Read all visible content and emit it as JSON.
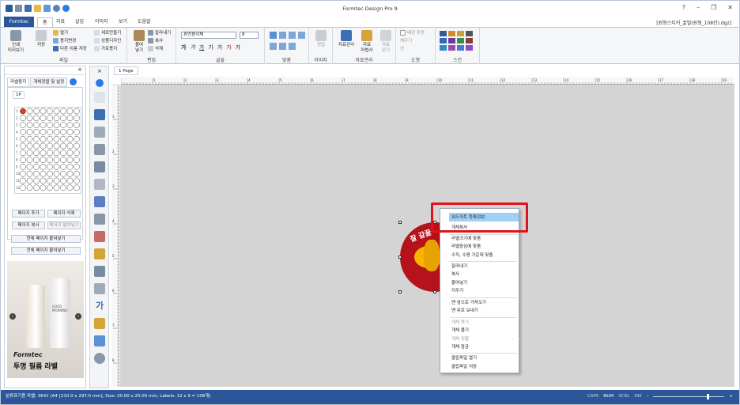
{
  "app": {
    "title": "Formtec Design Pro 9",
    "filename": "[원형스티커_꿀벌(원형_108칸).dgz]",
    "window_controls": [
      "?",
      "–",
      "❐",
      "✕"
    ]
  },
  "tabs": [
    "Formtec",
    "홈",
    "자료",
    "삽입",
    "이미지",
    "보기",
    "도움말"
  ],
  "ribbon": {
    "file": {
      "label": "파일",
      "print_preview": "인쇄\n미리보기",
      "save": "저장",
      "open": "열기",
      "paper_change": "용지변경",
      "save_as": "다른 이름 저장",
      "new_page": "새로만들기",
      "product_design": "상품디자인",
      "horizontal_paper": "가로용지"
    },
    "edit": {
      "label": "편집",
      "paste": "붙여\n넣기",
      "cut": "잘라내기",
      "copy": "복사",
      "delete": "삭제"
    },
    "font": {
      "label": "글꼴",
      "font_name": "휴먼편지체",
      "font_size": "8",
      "styles": [
        "가",
        "가",
        "가",
        "가",
        "가",
        "·",
        "가",
        "·",
        "가",
        "가"
      ]
    },
    "align": {
      "label": "맞춤"
    },
    "image": {
      "label": "이미지",
      "edit": "편집"
    },
    "data": {
      "label": "자료관리",
      "data_mgmt": "자료관리",
      "data_wizard": "자료\n마법사",
      "data_close": "자료\n닫기"
    },
    "shape": {
      "label": "도형",
      "fill": "배경 투명",
      "line_color": "채우기",
      "line": "선"
    },
    "skin": {
      "label": "스킨"
    }
  },
  "left_panel": {
    "tabs": [
      "라벨용지",
      "개체정렬 및 설정"
    ],
    "page_tab": "1P",
    "row_numbers": [
      "1",
      "2",
      "3",
      "4",
      "5",
      "6",
      "7",
      "8",
      "9",
      "10",
      "11",
      "12"
    ],
    "buttons": {
      "add_page": "페이지 추가",
      "delete_page": "페이지 삭제",
      "copy_page": "페이지 복사",
      "paste_page": "페이지 붙여넣기",
      "paste_current": "현재 페이지 붙여넣기",
      "paste_all": "전체 페이지 붙여넣기"
    },
    "ad": {
      "brand": "Formtec",
      "caption": "투명 필름 라벨",
      "bottle_text": "GOOD MORNING"
    }
  },
  "document": {
    "tab": "1 Page",
    "ruler_ticks_h": [
      "1",
      "2",
      "3",
      "4",
      "5",
      "6",
      "7",
      "8",
      "9",
      "10",
      "11",
      "12",
      "13",
      "14",
      "15",
      "16",
      "17",
      "18",
      "19",
      "20"
    ],
    "ruler_ticks_v": [
      "1",
      "2",
      "3",
      "4",
      "5",
      "6",
      "7",
      "8"
    ],
    "label_text": "잘 갈꿀"
  },
  "context_menu": {
    "items": [
      {
        "label": "워드아트 등록정보",
        "disabled": false,
        "highlighted": true
      },
      {
        "label": "개체복사",
        "disabled": false
      },
      {
        "label": "라벨크기에 맞춤",
        "disabled": false
      },
      {
        "label": "라벨중심에 맞춤",
        "disabled": false
      },
      {
        "label": "수직, 수평 가운데 맞춤",
        "disabled": false
      },
      {
        "label": "잘라내기",
        "disabled": false
      },
      {
        "label": "복사",
        "disabled": false
      },
      {
        "label": "붙여넣기",
        "disabled": false
      },
      {
        "label": "지우기",
        "disabled": false
      },
      {
        "label": "맨 앞으로 가져오기",
        "disabled": false
      },
      {
        "label": "맨 뒤로 보내기",
        "disabled": false
      },
      {
        "label": "개체 묶기",
        "disabled": true
      },
      {
        "label": "개체 풀기",
        "disabled": false
      },
      {
        "label": "개체 정렬",
        "disabled": true
      },
      {
        "label": "개체 잠금",
        "disabled": false
      },
      {
        "label": "클립파일 열기",
        "disabled": false
      },
      {
        "label": "클립파일 저장",
        "disabled": false
      }
    ]
  },
  "statusbar": {
    "info": "분류표기용 라벨: 3641 (A4 [210.0 x 297.0 mm], Size: 20.00 x 20.00 mm,  Labels: 12 x 9 = 108개)",
    "indicators": [
      {
        "label": "CAPS",
        "on": false
      },
      {
        "label": "NUM",
        "on": true
      },
      {
        "label": "SCRL",
        "on": false
      },
      {
        "label": "INS",
        "on": false
      }
    ]
  },
  "colors": {
    "accent": "#2b579a",
    "highlight_box": "#e0131b",
    "menu_highlight": "#9fd0f5",
    "label_red": "#b5121b",
    "bee_yellow": "#f7b500"
  }
}
